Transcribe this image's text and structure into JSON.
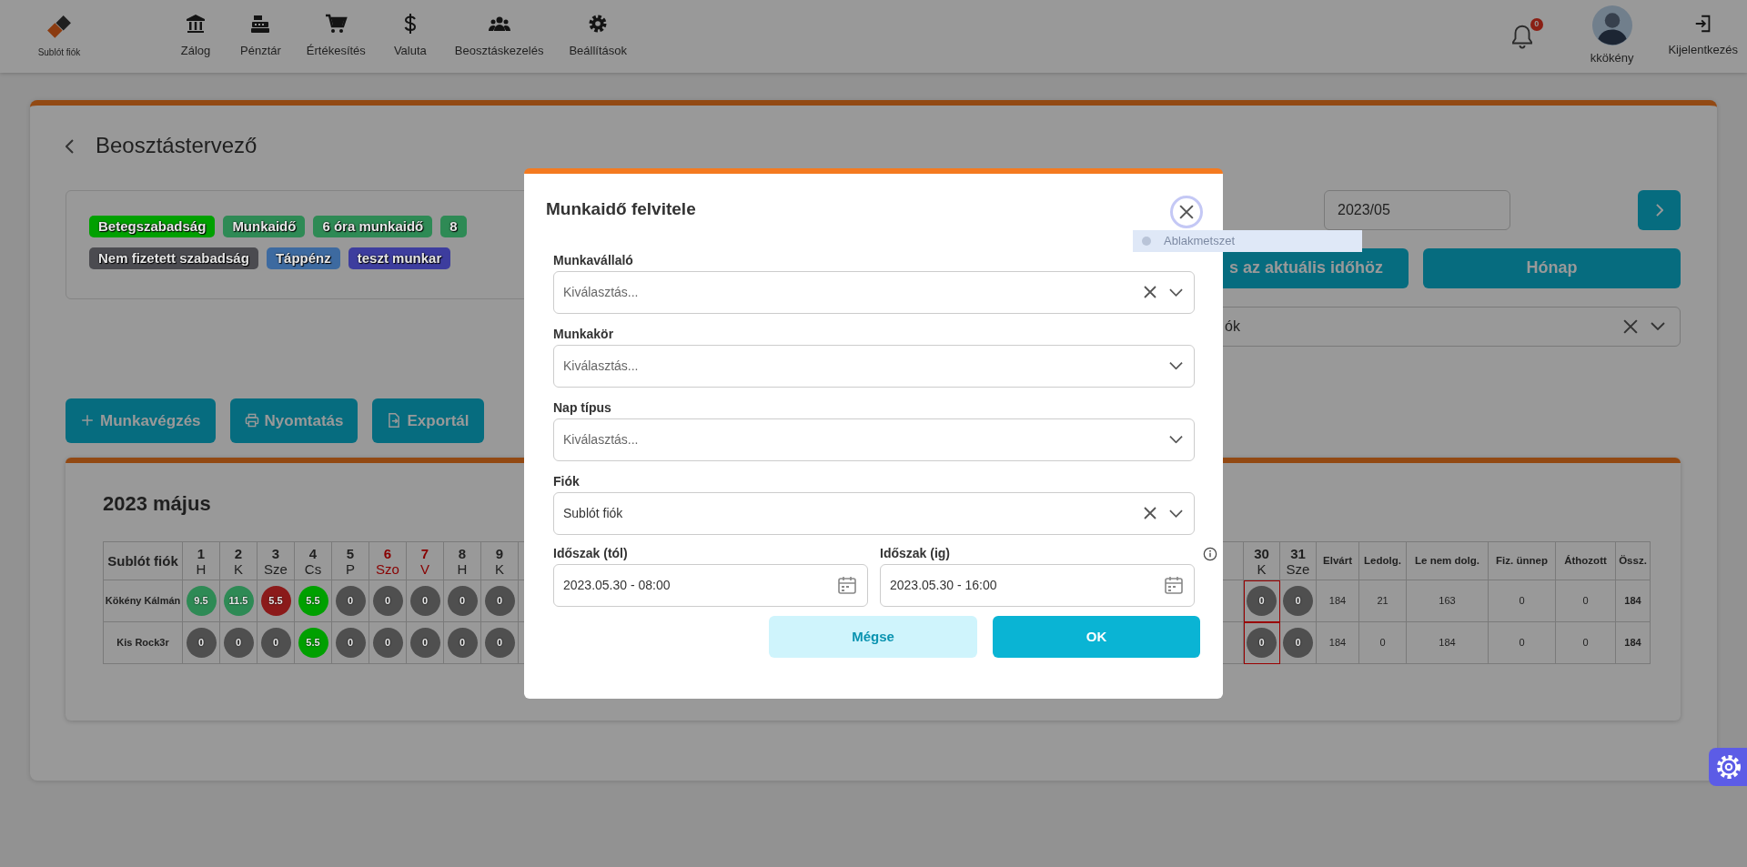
{
  "navbar": {
    "brand": "Sublót fiók",
    "items": [
      {
        "label": "Zálog",
        "kind": "bank"
      },
      {
        "label": "Pénztár",
        "kind": "register"
      },
      {
        "label": "Értékesítés",
        "kind": "cart"
      },
      {
        "label": "Valuta",
        "kind": "dollar"
      },
      {
        "label": "Beosztáskezelés",
        "kind": "people"
      },
      {
        "label": "Beállítások",
        "kind": "gear"
      }
    ],
    "notification_count": "0",
    "user": "kkökény",
    "logout": "Kijelentkezés"
  },
  "page": {
    "title": "Beosztástervező"
  },
  "legend": [
    {
      "label": "Betegszabadság",
      "color": "#00a000"
    },
    {
      "label": "Munkaidő",
      "color": "#2e8a55"
    },
    {
      "label": "6 óra munkaidő",
      "color": "#2e8a55"
    },
    {
      "label": "8",
      "color": "#2e8a55"
    },
    {
      "label": "Nem fizetett szabadság",
      "color": "#4b4b50"
    },
    {
      "label": "Táppénz",
      "color": "#3d6aa0"
    },
    {
      "label": "teszt munkar",
      "color": "#3d3d9e"
    }
  ],
  "period": {
    "value": "2023/05"
  },
  "view_buttons": [
    "s az aktuális időhöz",
    "Hónap"
  ],
  "branch_select": {
    "value": "ók"
  },
  "actions": [
    {
      "label": "Munkavégzés",
      "kind": "plus"
    },
    {
      "label": "Nyomtatás",
      "kind": "print"
    },
    {
      "label": "Exportál",
      "kind": "export"
    }
  ],
  "schedule": {
    "title": "2023 május",
    "corner": "Sublót fiók",
    "days": [
      {
        "day": "1",
        "weekday": "H",
        "weekend": false,
        "today": false
      },
      {
        "day": "2",
        "weekday": "K",
        "weekend": false,
        "today": false
      },
      {
        "day": "3",
        "weekday": "Sze",
        "weekend": false,
        "today": false
      },
      {
        "day": "4",
        "weekday": "Cs",
        "weekend": false,
        "today": false
      },
      {
        "day": "5",
        "weekday": "P",
        "weekend": false,
        "today": false
      },
      {
        "day": "6",
        "weekday": "Szo",
        "weekend": true,
        "today": false
      },
      {
        "day": "7",
        "weekday": "V",
        "weekend": true,
        "today": false
      },
      {
        "day": "8",
        "weekday": "H",
        "weekend": false,
        "today": false
      },
      {
        "day": "9",
        "weekday": "K",
        "weekend": false,
        "today": false
      },
      {
        "day": "30",
        "weekday": "K",
        "weekend": false,
        "today": true
      },
      {
        "day": "31",
        "weekday": "Sze",
        "weekend": false,
        "today": false
      }
    ],
    "summary_columns": [
      "Elvárt",
      "Ledolg.",
      "Le nem dolg.",
      "Fiz. ünnep",
      "Áthozott",
      "Össz."
    ],
    "rows": [
      {
        "name": "Kökény Kálmán",
        "cells": [
          {
            "value": "9.5",
            "color": "#2e8a55"
          },
          {
            "value": "11.5",
            "color": "#2e8a55"
          },
          {
            "value": "5.5",
            "color": "#8b1a1a"
          },
          {
            "value": "5.5",
            "color": "#00a000"
          },
          {
            "value": "0",
            "color": "#4f4f4f"
          },
          {
            "value": "0",
            "color": "#4f4f4f"
          },
          {
            "value": "0",
            "color": "#4f4f4f"
          },
          {
            "value": "0",
            "color": "#4f4f4f"
          },
          {
            "value": "0",
            "color": "#4f4f4f"
          },
          {
            "value": "0",
            "color": "#4f4f4f"
          },
          {
            "value": "0",
            "color": "#4f4f4f"
          }
        ],
        "summary": [
          "184",
          "21",
          "163",
          "0",
          "0",
          "184"
        ]
      },
      {
        "name": "Kis Rock3r",
        "cells": [
          {
            "value": "0",
            "color": "#4f4f4f"
          },
          {
            "value": "0",
            "color": "#4f4f4f"
          },
          {
            "value": "0",
            "color": "#4f4f4f"
          },
          {
            "value": "5.5",
            "color": "#00a000"
          },
          {
            "value": "0",
            "color": "#4f4f4f"
          },
          {
            "value": "0",
            "color": "#4f4f4f"
          },
          {
            "value": "0",
            "color": "#4f4f4f"
          },
          {
            "value": "0",
            "color": "#4f4f4f"
          },
          {
            "value": "0",
            "color": "#4f4f4f"
          },
          {
            "value": "0",
            "color": "#4f4f4f"
          },
          {
            "value": "0",
            "color": "#4f4f4f"
          }
        ],
        "summary": [
          "184",
          "0",
          "184",
          "0",
          "0",
          "184"
        ]
      }
    ]
  },
  "modal": {
    "title": "Munkaidő felvitele",
    "fields": [
      {
        "label": "Munkavállaló",
        "placeholder": "Kiválasztás...",
        "clearable": true
      },
      {
        "label": "Munkakör",
        "placeholder": "Kiválasztás...",
        "clearable": false
      },
      {
        "label": "Nap típus",
        "placeholder": "Kiválasztás...",
        "clearable": false
      },
      {
        "label": "Fiók",
        "value": "Sublót fiók",
        "clearable": true
      }
    ],
    "period_from": {
      "label": "Időszak (tól)",
      "value": "2023.05.30 - 08:00"
    },
    "period_to": {
      "label": "Időszak (ig)",
      "value": "2023.05.30 - 16:00"
    },
    "cancel": "Mégse",
    "ok": "OK"
  },
  "snip_tooltip": "Ablakmetszet"
}
